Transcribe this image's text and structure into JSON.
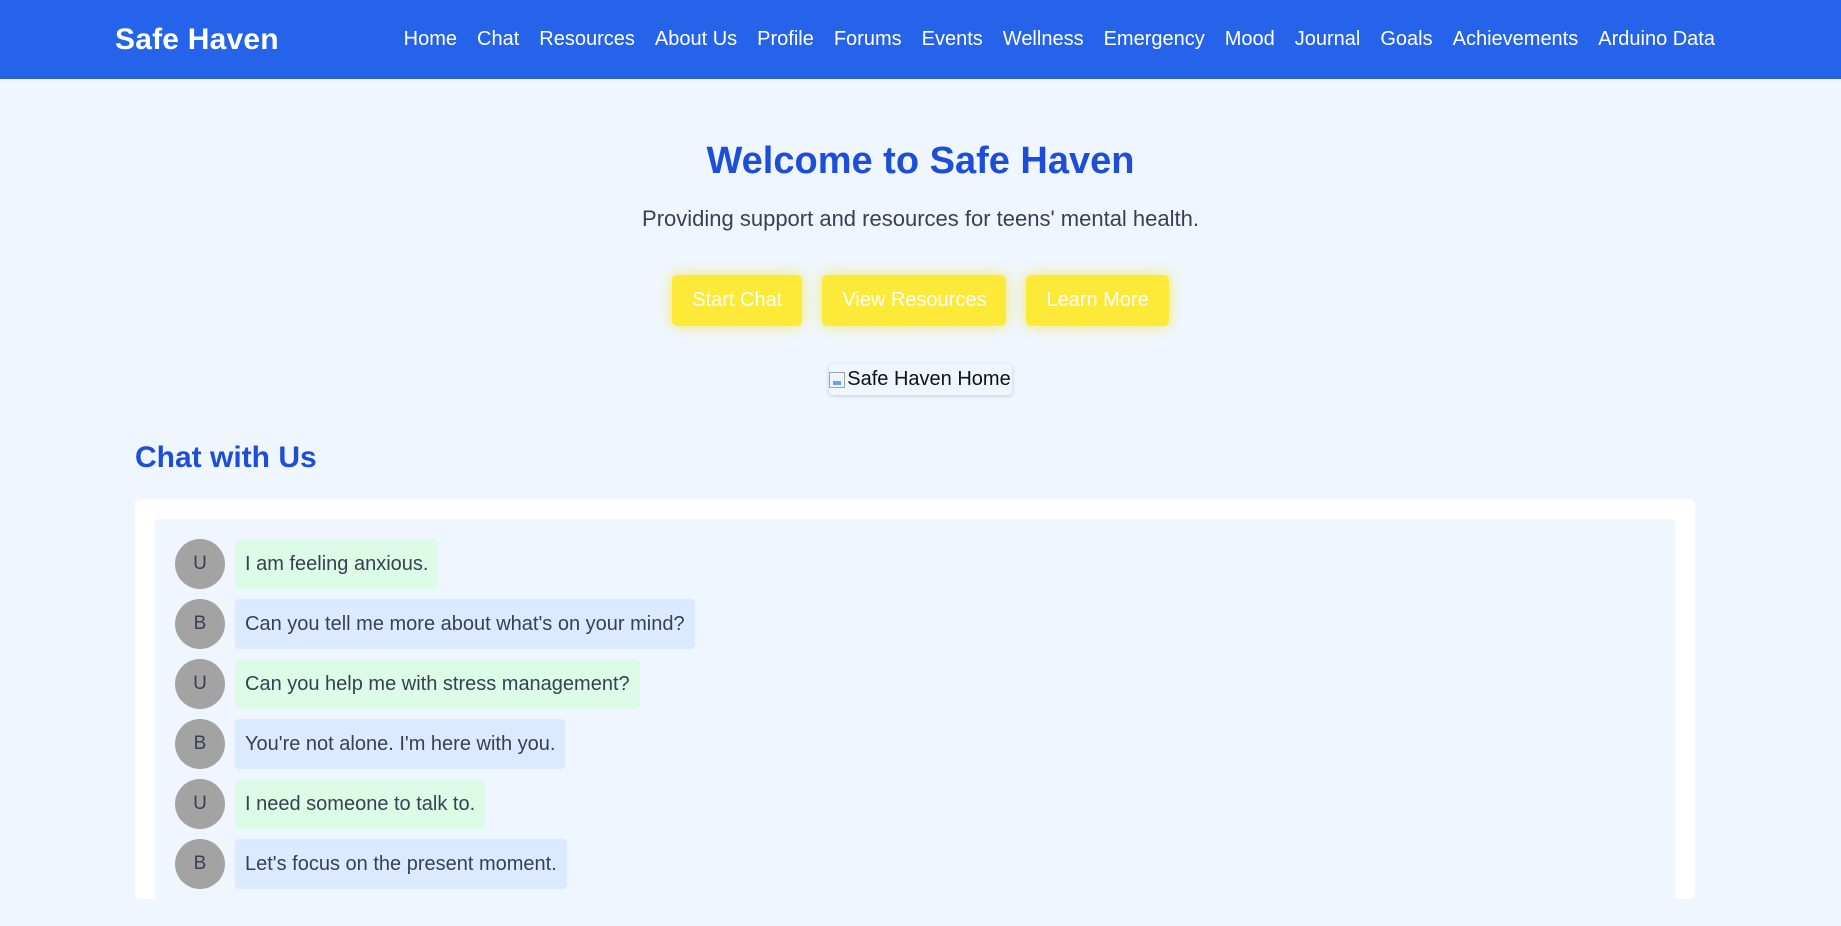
{
  "header": {
    "brand": "Safe Haven",
    "nav": [
      {
        "label": "Home"
      },
      {
        "label": "Chat"
      },
      {
        "label": "Resources"
      },
      {
        "label": "About Us"
      },
      {
        "label": "Profile"
      },
      {
        "label": "Forums"
      },
      {
        "label": "Events"
      },
      {
        "label": "Wellness"
      },
      {
        "label": "Emergency"
      },
      {
        "label": "Mood"
      },
      {
        "label": "Journal"
      },
      {
        "label": "Goals"
      },
      {
        "label": "Achievements"
      },
      {
        "label": "Arduino Data"
      }
    ]
  },
  "hero": {
    "title": "Welcome to Safe Haven",
    "subtitle": "Providing support and resources for teens' mental health.",
    "buttons": [
      {
        "label": "Start Chat"
      },
      {
        "label": "View Resources"
      },
      {
        "label": "Learn More"
      }
    ],
    "image_alt": "Safe Haven Home"
  },
  "chat": {
    "heading": "Chat with Us",
    "messages": [
      {
        "sender": "user",
        "avatar": "U",
        "text": "I am feeling anxious."
      },
      {
        "sender": "bot",
        "avatar": "B",
        "text": "Can you tell me more about what's on your mind?"
      },
      {
        "sender": "user",
        "avatar": "U",
        "text": "Can you help me with stress management?"
      },
      {
        "sender": "bot",
        "avatar": "B",
        "text": "You're not alone. I'm here with you."
      },
      {
        "sender": "user",
        "avatar": "U",
        "text": "I need someone to talk to."
      },
      {
        "sender": "bot",
        "avatar": "B",
        "text": "Let's focus on the present moment."
      }
    ]
  },
  "colors": {
    "nav_bg": "#2563eb",
    "heading": "#1d4ed8",
    "page_bg": "#eff6ff",
    "button_bg": "#fde938",
    "user_bubble": "#dcfce7",
    "bot_bubble": "#dbeafe",
    "avatar_bg": "#a3a3a3"
  }
}
